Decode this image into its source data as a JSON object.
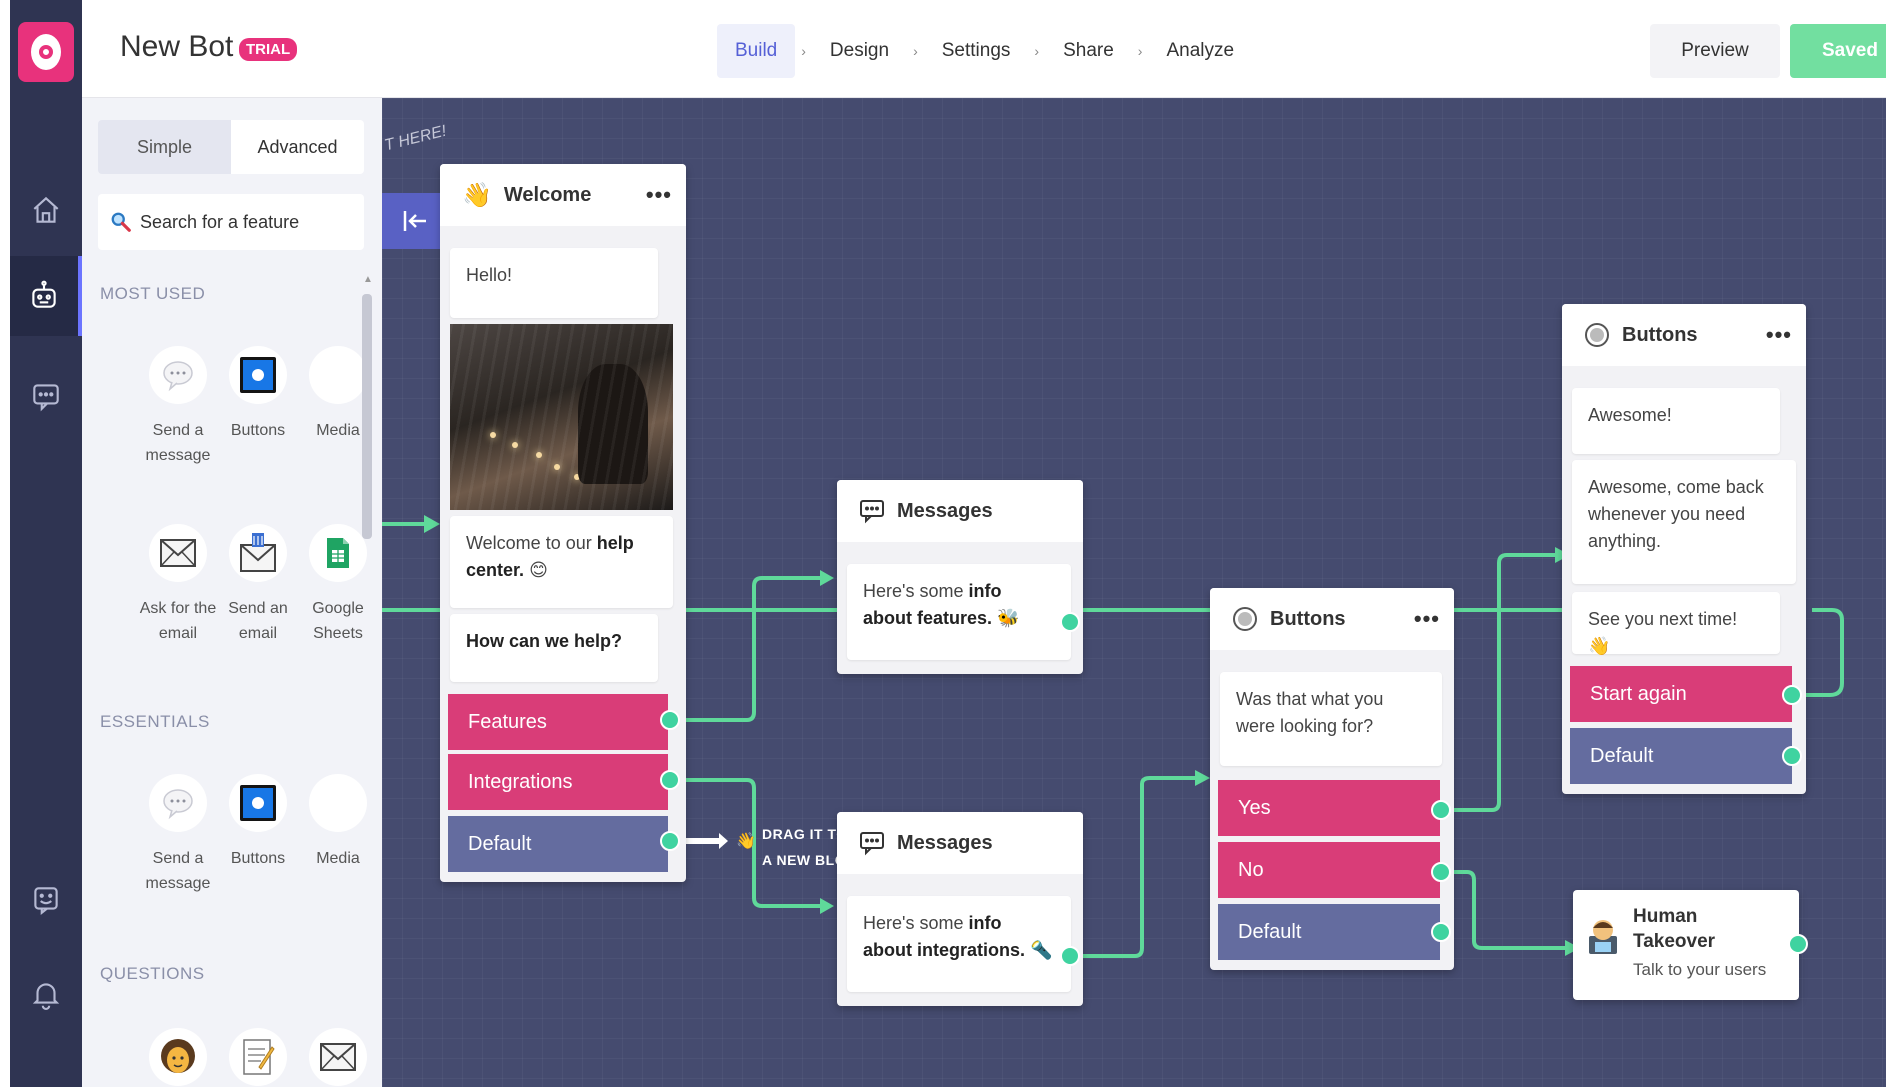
{
  "app": {
    "bot_name": "New Bot",
    "trial_badge": "TRIAL",
    "steps": [
      "Build",
      "Design",
      "Settings",
      "Share",
      "Analyze"
    ],
    "active_step": "Build",
    "step_separator": "›",
    "preview_label": "Preview",
    "saved_label": "Saved",
    "accent_color": "#e8327c",
    "success_color": "#72dfa0"
  },
  "rail": {
    "items": [
      "home-icon",
      "bot-icon",
      "chat-icon",
      "feedback-icon",
      "bell-icon"
    ],
    "active": "bot-icon"
  },
  "panel": {
    "modes": {
      "simple": "Simple",
      "advanced": "Advanced"
    },
    "active_mode": "Advanced",
    "search_placeholder": "Search for a feature",
    "sections": {
      "most_used": "MOST USED",
      "essentials": "ESSENTIALS",
      "questions": "QUESTIONS"
    },
    "most_used": [
      {
        "label": "Send a message",
        "icon": "speech-bubble-icon"
      },
      {
        "label": "Buttons",
        "icon": "buttons-icon"
      },
      {
        "label": "Media",
        "icon": "media-icon"
      },
      {
        "label": "Ask for the email",
        "icon": "envelope-icon"
      },
      {
        "label": "Send an email",
        "icon": "send-email-icon"
      },
      {
        "label": "Google Sheets",
        "icon": "sheets-icon"
      }
    ],
    "essentials": [
      {
        "label": "Send a message",
        "icon": "speech-bubble-icon"
      },
      {
        "label": "Buttons",
        "icon": "buttons-icon"
      },
      {
        "label": "Media",
        "icon": "media-icon"
      }
    ],
    "questions": [
      {
        "icon": "person-icon"
      },
      {
        "icon": "memo-icon"
      },
      {
        "icon": "envelope-icon"
      }
    ]
  },
  "canvas": {
    "start_note": "T HERE!",
    "drag_note": [
      "DRAG IT TO",
      "A NEW BLO"
    ],
    "blocks": {
      "welcome": {
        "title": "Welcome",
        "messages": [
          "Hello!",
          "How can we help?"
        ],
        "rich_message": {
          "prefix": "Welcome to our ",
          "bold": "help center.",
          "emoji": "😊"
        },
        "options": [
          "Features",
          "Integrations",
          "Default"
        ]
      },
      "messages_features": {
        "title": "Messages",
        "text": {
          "prefix": "Here's some ",
          "bold": "info about features.",
          "emoji": "🐝"
        }
      },
      "messages_integrations": {
        "title": "Messages",
        "text": {
          "prefix": "Here's some ",
          "bold": "info about integrations.",
          "emoji": "🔦"
        }
      },
      "buttons_question": {
        "title": "Buttons",
        "question": "Was that what you were looking for?",
        "options": [
          "Yes",
          "No",
          "Default"
        ]
      },
      "buttons_end": {
        "title": "Buttons",
        "messages": [
          "Awesome!",
          "Awesome, come back whenever you need anything.",
          "See you next time! 👋"
        ],
        "options": [
          "Start again",
          "Default"
        ]
      },
      "human": {
        "title_line1": "Human",
        "title_line2": "Takeover",
        "subtitle": "Talk to your users"
      }
    },
    "colors": {
      "option_primary": "#d93d78",
      "option_default": "#646c9f",
      "wire": "#5fd99a",
      "canvas": "#454b6f"
    }
  }
}
